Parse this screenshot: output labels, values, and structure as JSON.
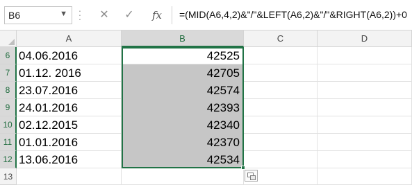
{
  "formula_bar": {
    "name_box": "B6",
    "cancel_icon": "✕",
    "enter_icon": "✓",
    "insert_function_label": "fx",
    "formula": "=(MID(A6,4,2)&\"/\"&LEFT(A6,2)&\"/\"&RIGHT(A6,2))+0"
  },
  "columns": [
    "A",
    "B",
    "C",
    "D"
  ],
  "rows": [
    {
      "num": "6",
      "a": "04.06.2016",
      "b": "42525"
    },
    {
      "num": "7",
      "a": "01.12. 2016",
      "b": "42705"
    },
    {
      "num": "8",
      "a": "23.07.2016",
      "b": "42574"
    },
    {
      "num": "9",
      "a": "24.01.2016",
      "b": "42393"
    },
    {
      "num": "10",
      "a": "02.12.2015",
      "b": "42340"
    },
    {
      "num": "11",
      "a": "01.01.2016",
      "b": "42370"
    },
    {
      "num": "12",
      "a": "13.06.2016",
      "b": "42534"
    },
    {
      "num": "13",
      "a": "",
      "b": ""
    }
  ],
  "colors": {
    "accent": "#217346",
    "selection": "#c6c6c6"
  }
}
